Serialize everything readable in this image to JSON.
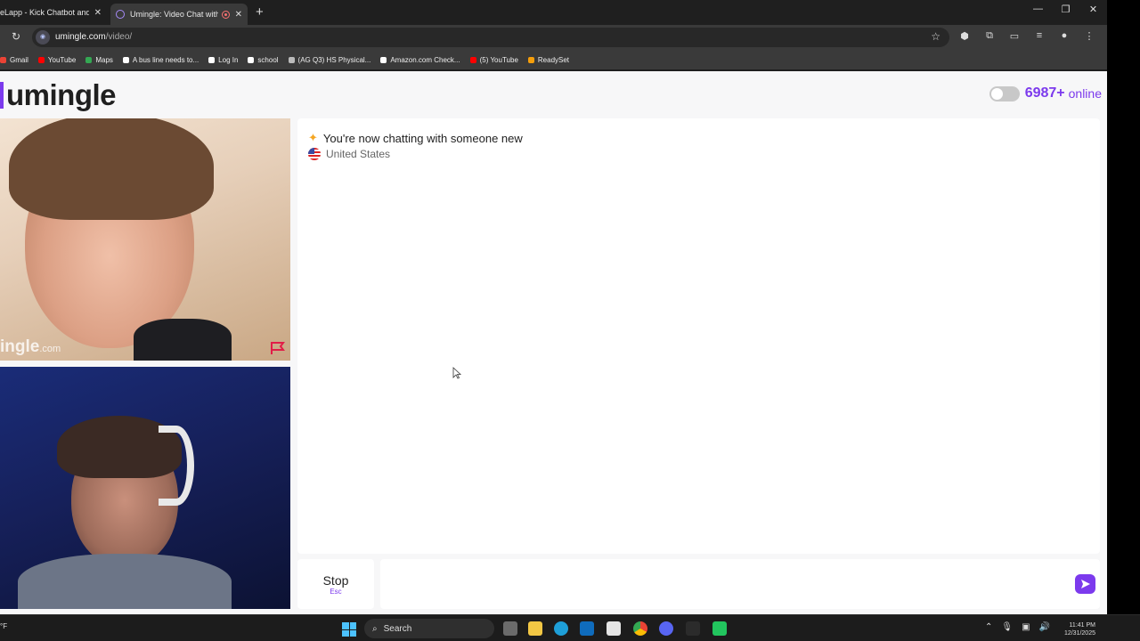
{
  "browser": {
    "tabs": [
      {
        "label": "eLapp - Kick Chatbot and",
        "active": false
      },
      {
        "label": "Umingle: Video Chat with S",
        "active": true
      }
    ],
    "address": {
      "host": "umingle.com",
      "path": "/video/"
    },
    "bookmarks": [
      {
        "label": "Gmail",
        "icon": "gmail-icon",
        "color": "#ea4335"
      },
      {
        "label": "YouTube",
        "icon": "youtube-icon",
        "color": "#ff0000"
      },
      {
        "label": "Maps",
        "icon": "maps-icon",
        "color": "#34a853"
      },
      {
        "label": "A bus line needs to...",
        "icon": "bookmark-icon",
        "color": "#ffffff"
      },
      {
        "label": "Log In",
        "icon": "school-app-icon",
        "color": "#ffffff"
      },
      {
        "label": "school",
        "icon": "school-app-icon",
        "color": "#ffffff"
      },
      {
        "label": "(AG Q3) HS Physical...",
        "icon": "globe-icon",
        "color": "#bbbbbb"
      },
      {
        "label": "Amazon.com Check...",
        "icon": "amazon-icon",
        "color": "#ffffff"
      },
      {
        "label": "(5) YouTube",
        "icon": "youtube-icon",
        "color": "#ff0000"
      },
      {
        "label": "ReadySet",
        "icon": "readyset-icon",
        "color": "#f59e0b"
      }
    ]
  },
  "page": {
    "logo": "umingle",
    "online_count": "6987+",
    "online_label": "online",
    "watermark_main": "ingle",
    "watermark_suffix": ".com",
    "chat_status": "You're now chatting with someone new",
    "chat_country": "United States",
    "stop_label": "Stop",
    "stop_shortcut": "Esc",
    "message_value": "",
    "accent_color": "#7c3aed"
  },
  "taskbar": {
    "weather": "°F",
    "search_label": "Search",
    "time": "11:41 PM",
    "date": "12/31/2025"
  }
}
